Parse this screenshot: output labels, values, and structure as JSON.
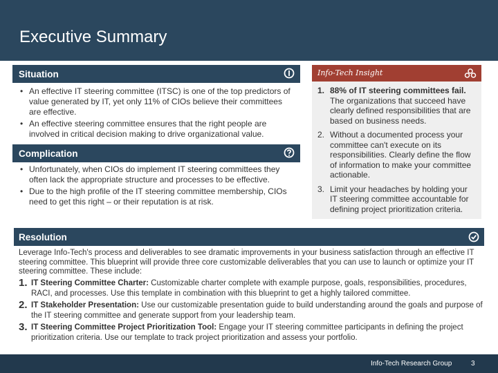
{
  "header": {
    "title": "Executive Summary"
  },
  "situation": {
    "title": "Situation",
    "icon": "info-icon",
    "bullets": [
      "An effective IT steering committee (ITSC) is one of the top predictors of value generated by IT, yet only 11% of CIOs believe their committees are effective.",
      "An effective steering committee ensures that the right people are involved in critical decision making to drive organizational value."
    ]
  },
  "complication": {
    "title": "Complication",
    "icon": "question-icon",
    "bullets": [
      "Unfortunately, when CIOs do implement IT steering committees they often lack the appropriate structure and processes to be effective.",
      "Due to the high profile of the IT steering committee membership, CIOs need to get this right – or their reputation is at risk."
    ]
  },
  "insight": {
    "title": "Info-Tech Insight",
    "icon": "gears-icon",
    "items": [
      {
        "num": "1.",
        "bold": "88% of IT steering committees fail.",
        "text": "The organizations that succeed have clearly defined responsibilities that are based on business needs."
      },
      {
        "num": "2.",
        "bold": "",
        "text": "Without a documented process your committee can't execute on its responsibilities. Clearly define the flow of information to make your committee actionable."
      },
      {
        "num": "3.",
        "bold": "",
        "text": "Limit your headaches by holding your IT steering committee accountable for defining project prioritization criteria."
      }
    ]
  },
  "resolution": {
    "title": "Resolution",
    "icon": "check-circle-icon",
    "intro": "Leverage Info-Tech's process and deliverables to see dramatic improvements in your business satisfaction through an effective IT steering committee. This blueprint will provide three core customizable deliverables that you can use to launch or optimize your IT steering committee. These include:",
    "items": [
      {
        "num": "1.",
        "bold": "IT Steering Committee Charter:",
        "text": " Customizable charter complete with example purpose, goals, responsibilities, procedures, RACI, and processes. Use this template in combination with this blueprint to get a highly tailored committee."
      },
      {
        "num": "2.",
        "bold": "IT Stakeholder Presentation:",
        "text": " Use our customizable presentation guide to build understanding around the goals and purpose of the IT steering committee and generate support from your leadership team."
      },
      {
        "num": "3.",
        "bold": "IT Steering Committee Project Prioritization Tool:",
        "text": " Engage your IT steering committee participants in defining the project prioritization criteria. Use our template to track project prioritization and assess your portfolio."
      }
    ]
  },
  "footer": {
    "organization": "Info-Tech Research Group",
    "page_number": "3"
  },
  "colors": {
    "navy": "#2b475e",
    "accent_red": "#a13f32",
    "insight_bg": "#efefef",
    "footer": "#22394d"
  }
}
